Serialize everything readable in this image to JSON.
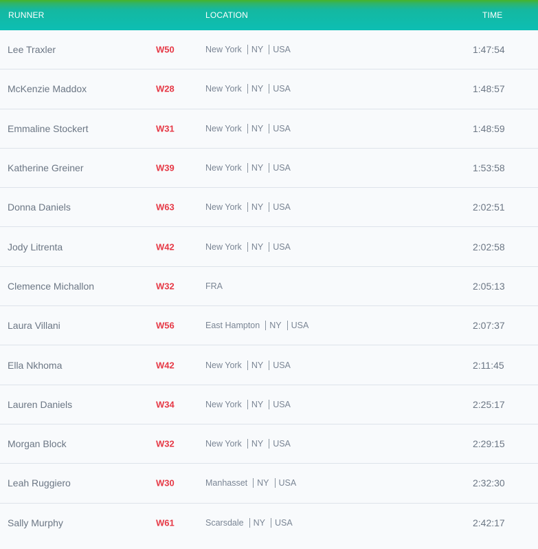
{
  "headers": {
    "runner": "RUNNER",
    "location": "LOCATION",
    "time": "TIME"
  },
  "colors": {
    "header_top": "#46b42a",
    "header_bottom": "#0dbeb3",
    "division": "#e63946"
  },
  "rows": [
    {
      "name": "Lee Traxler",
      "division": "W50",
      "location": [
        "New York",
        "NY",
        "USA"
      ],
      "time": "1:47:54"
    },
    {
      "name": "McKenzie Maddox",
      "division": "W28",
      "location": [
        "New York",
        "NY",
        "USA"
      ],
      "time": "1:48:57"
    },
    {
      "name": "Emmaline Stockert",
      "division": "W31",
      "location": [
        "New York",
        "NY",
        "USA"
      ],
      "time": "1:48:59"
    },
    {
      "name": "Katherine Greiner",
      "division": "W39",
      "location": [
        "New York",
        "NY",
        "USA"
      ],
      "time": "1:53:58"
    },
    {
      "name": "Donna Daniels",
      "division": "W63",
      "location": [
        "New York",
        "NY",
        "USA"
      ],
      "time": "2:02:51"
    },
    {
      "name": "Jody Litrenta",
      "division": "W42",
      "location": [
        "New York",
        "NY",
        "USA"
      ],
      "time": "2:02:58"
    },
    {
      "name": "Clemence Michallon",
      "division": "W32",
      "location": [
        "FRA"
      ],
      "time": "2:05:13"
    },
    {
      "name": "Laura Villani",
      "division": "W56",
      "location": [
        "East Hampton",
        "NY",
        "USA"
      ],
      "time": "2:07:37"
    },
    {
      "name": "Ella Nkhoma",
      "division": "W42",
      "location": [
        "New York",
        "NY",
        "USA"
      ],
      "time": "2:11:45"
    },
    {
      "name": "Lauren Daniels",
      "division": "W34",
      "location": [
        "New York",
        "NY",
        "USA"
      ],
      "time": "2:25:17"
    },
    {
      "name": "Morgan Block",
      "division": "W32",
      "location": [
        "New York",
        "NY",
        "USA"
      ],
      "time": "2:29:15"
    },
    {
      "name": "Leah Ruggiero",
      "division": "W30",
      "location": [
        "Manhasset",
        "NY",
        "USA"
      ],
      "time": "2:32:30"
    },
    {
      "name": "Sally Murphy",
      "division": "W61",
      "location": [
        "Scarsdale",
        "NY",
        "USA"
      ],
      "time": "2:42:17"
    }
  ]
}
